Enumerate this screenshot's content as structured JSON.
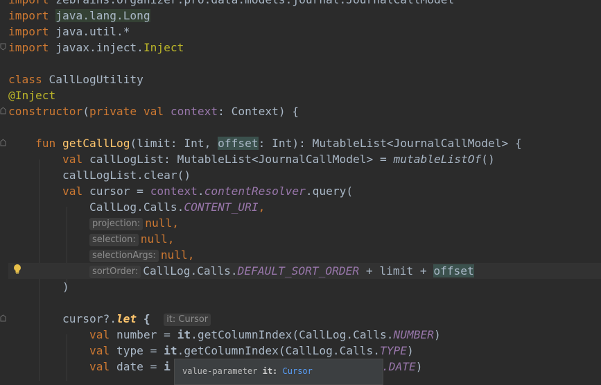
{
  "code": {
    "l0": "import zebrains.organizer.pro.data.models.journal.JournalCallModel",
    "import_kw": "import",
    "l1_path": "java.lang.Long",
    "l2_path": "java.util.*",
    "l3_path": "javax.inject.Inject",
    "class_kw": "class",
    "class_name": "CallLogUtility",
    "inject_ann": "@Inject",
    "constructor_kw": "constructor",
    "private_val": "private val",
    "context": "context",
    "ctor_rest": ": Context) {",
    "paren_open": "(",
    "fun_kw": "fun",
    "fn_name": "getCallLog",
    "fn_params_a": "(limit: Int, ",
    "offset": "offset",
    "fn_params_b": ": Int): MutableList<JournalCallModel> {",
    "val_kw": "val",
    "calllog_decl": " callLogList: MutableList<JournalCallModel> = ",
    "mutable_list_of": "mutableListOf",
    "empty_call": "()",
    "clear_call": "callLogList.clear()",
    "cursor_eq": " cursor = ",
    "dot": ".",
    "content_resolver": "contentResolver",
    "query_open": ".query(",
    "calllog_calls": "CallLog.Calls.",
    "content_uri": "CONTENT_URI",
    "comma": ",",
    "null_comma": "null,",
    "default_sort_order": "DEFAULT_SORT_ORDER",
    "plus_limit_plus": " + limit + ",
    "close_paren": ")",
    "cursor_let": "cursor?.",
    "let": "let",
    "brace_open": " {",
    "number_decl": " number = ",
    "type_decl": " type = ",
    "date_decl": " date = ",
    "it_kw": "it",
    "get_col": ".getColumnIndex(CallLog.Calls.",
    "number_const": "NUMBER",
    "type_const": "TYPE",
    "date_const": ".DATE",
    "close_paren_only": ")",
    "i_char": "i"
  },
  "hints": {
    "projection": "projection:",
    "selection": "selection:",
    "selection_args": "selectionArgs:",
    "sort_order": "sortOrder:",
    "it_cursor": "it: Cursor"
  },
  "tooltip": {
    "prefix": "value-parameter ",
    "name": "it:",
    "type": "Cursor"
  },
  "icons": {
    "intention": "lightbulb-icon",
    "fold": "fold-marker-icon"
  },
  "colors": {
    "background": "#2b2b2b",
    "keyword": "#cc7832",
    "annotation": "#bbb529",
    "function": "#ffc66d",
    "property": "#9876aa",
    "text": "#a9b7c6"
  }
}
